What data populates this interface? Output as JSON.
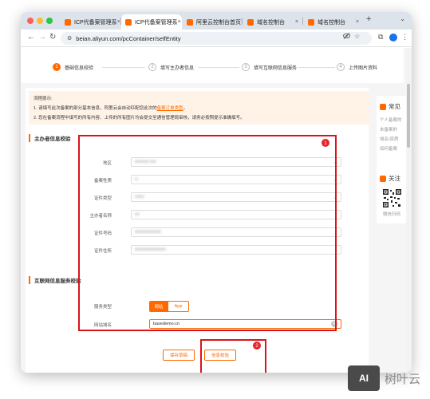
{
  "colors": {
    "accent": "#ff6a00",
    "annotation_red": "#d8141b",
    "traffic_close": "#ff5f57",
    "traffic_min": "#febc2e",
    "traffic_max": "#28c840"
  },
  "browser": {
    "tabs": [
      {
        "label": "ICP代备案管理系",
        "active": false
      },
      {
        "label": "ICP代备案管理系",
        "active": true
      },
      {
        "label": "阿里云控制台首页",
        "active": false
      },
      {
        "label": "域名控制台",
        "active": false
      },
      {
        "label": "域名控制台",
        "active": false
      }
    ],
    "tab_close_glyph": "×",
    "new_tab_glyph": "+",
    "tab_overflow_glyph": "⌄",
    "url": "beian.aliyun.com/pcContainer/selfEntity",
    "nav": {
      "back": "←",
      "forward": "→",
      "reload": "↻"
    }
  },
  "steps": [
    {
      "num": "1",
      "label": "基础信息校验",
      "active": true
    },
    {
      "num": "2",
      "label": "填写主办者信息",
      "active": false
    },
    {
      "num": "3",
      "label": "填写互联网信息服务",
      "active": false
    },
    {
      "num": "4",
      "label": "上传图片资料",
      "active": false
    }
  ],
  "notice": {
    "title": "流程提示:",
    "line1_prefix": "1. 请填写此次备案的部分基本信息，阿里云会自动匹配您此次的",
    "line1_link": "备案订单类型",
    "line1_suffix": "。",
    "line2": "2. 您在备案流程中填写的所有内容、上传的所有图片均会提交至通信管理局审核，请务必按照提示准确填写。"
  },
  "sponsor_section": {
    "title": "主办者信息校验",
    "fields": [
      {
        "label": "地区",
        "value": "▪▪▪▪▪▪▪▪▪ ▪▪▪▪",
        "type": "select"
      },
      {
        "label": "备案性质",
        "value": "▪▪",
        "type": "select"
      },
      {
        "label": "证件类型",
        "value": "▪▪▪▪▪▪",
        "type": "select"
      },
      {
        "label": "主办者名称",
        "value": "▪▪▪",
        "type": "input"
      },
      {
        "label": "证件号码",
        "value": "▪▪▪▪▪▪▪▪▪▪▪▪▪▪▪▪▪",
        "type": "input"
      },
      {
        "label": "证件住所",
        "value": "▪▪▪▪▪▪▪▪▪▪▪▪▪▪▪▪▪▪▪▪",
        "type": "input"
      }
    ]
  },
  "service_section": {
    "title": "互联网信息服务校验",
    "service_type_label": "服务类型",
    "service_types": [
      "网站",
      "App"
    ],
    "domain_label": "网站域名",
    "domain_value": "basedemo.cn"
  },
  "buttons": {
    "save_draft": "保存草稿",
    "verify": "信息校验"
  },
  "annotations": {
    "badge1": "1",
    "badge2": "2"
  },
  "right_panel": {
    "faq_title": "常见",
    "faq_items": [
      "个人备案的",
      "未备案的",
      "域名/资质",
      "如何备案"
    ],
    "follow_title": "关注",
    "wechat_scan": "微信扫码"
  },
  "watermark": {
    "icon_text": "AI",
    "text": "树叶云"
  }
}
